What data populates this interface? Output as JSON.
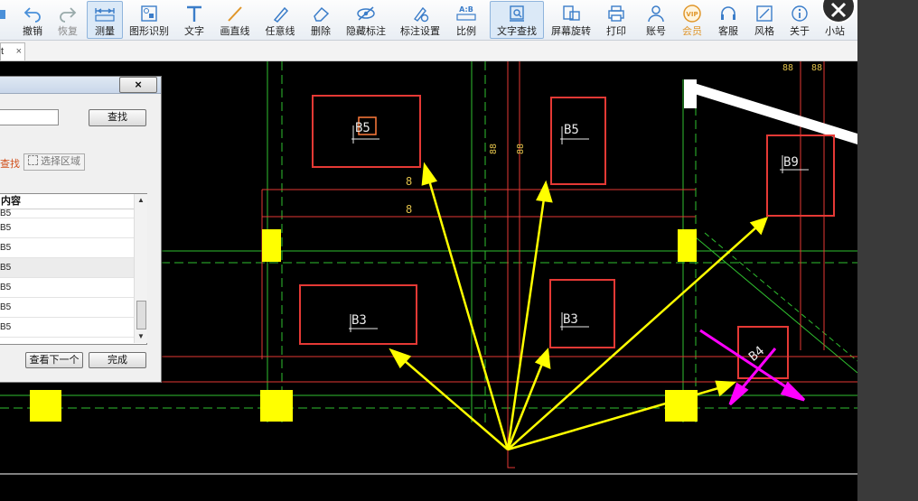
{
  "toolbar": {
    "items": [
      {
        "label": "撤销",
        "icon": "undo-icon"
      },
      {
        "label": "恢复",
        "icon": "redo-icon"
      },
      {
        "label": "测量",
        "icon": "measure-icon"
      },
      {
        "label": "图形识别",
        "icon": "shape-recognition-icon"
      },
      {
        "label": "文字",
        "icon": "text-icon"
      },
      {
        "label": "画直线",
        "icon": "line-icon"
      },
      {
        "label": "任意线",
        "icon": "freehand-icon"
      },
      {
        "label": "删除",
        "icon": "eraser-icon"
      },
      {
        "label": "隐藏标注",
        "icon": "hide-annotation-icon"
      },
      {
        "label": "标注设置",
        "icon": "annotation-settings-icon"
      },
      {
        "label": "比例",
        "icon": "scale-icon",
        "icon_text": "A:B"
      },
      {
        "label": "文字查找",
        "icon": "text-search-icon"
      },
      {
        "label": "屏幕旋转",
        "icon": "rotate-screen-icon"
      },
      {
        "label": "打印",
        "icon": "print-icon"
      },
      {
        "label": "账号",
        "icon": "account-icon"
      },
      {
        "label": "会员",
        "icon": "vip-icon",
        "icon_text": "VIP"
      },
      {
        "label": "客服",
        "icon": "headset-icon"
      },
      {
        "label": "风格",
        "icon": "style-icon"
      },
      {
        "label": "关于",
        "icon": "about-icon"
      },
      {
        "label": "小站",
        "icon": "station-icon"
      }
    ]
  },
  "tab": {
    "label": "t",
    "close": "×"
  },
  "dialog": {
    "close": "×",
    "find_button": "查找",
    "search_link": "查找",
    "select_area": "选择区域",
    "column_header": "内容",
    "rows": [
      "B5",
      "B5",
      "B5",
      "B5",
      "B5",
      "B5",
      "B5"
    ],
    "next_button": "查看下一个",
    "done_button": "完成"
  },
  "canvas": {
    "labels": [
      "B5",
      "B5",
      "B9",
      "B3",
      "B3",
      "B4",
      "8",
      "8"
    ],
    "small_marks": [
      "88",
      "88",
      "88",
      "88"
    ]
  },
  "colors": {
    "background": "#000000",
    "cad_red": "#e53935",
    "cad_green": "#2fbf2f",
    "arrow_yellow": "#ffff00",
    "arrow_magenta": "#ff00ff",
    "column_yellow": "#ffff00",
    "active_tool_bg": "#dbe9f7"
  }
}
